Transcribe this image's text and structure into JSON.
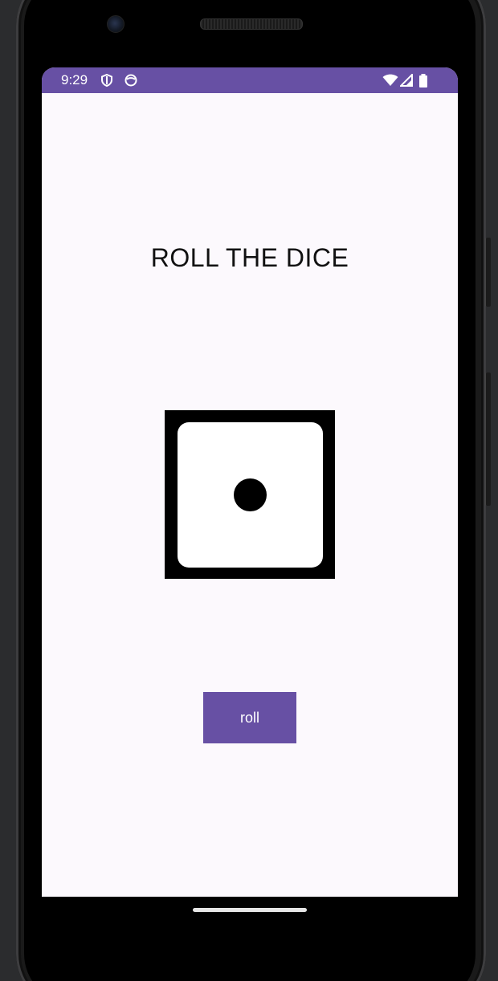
{
  "status_bar": {
    "time": "9:29",
    "left_icons": [
      "shield-icon",
      "face-icon"
    ],
    "right_icons": [
      "wifi-icon",
      "signal-icon",
      "battery-icon"
    ],
    "color": "#6750a4"
  },
  "app": {
    "title": "ROLL THE DICE",
    "dice_value": 1,
    "roll_button_label": "roll",
    "accent_color": "#6750a4",
    "background_color": "#fcf9fd"
  }
}
